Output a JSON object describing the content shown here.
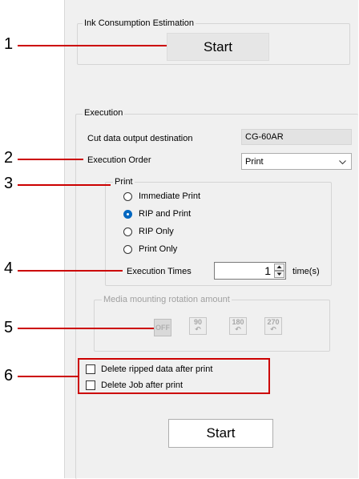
{
  "callouts": [
    "1",
    "2",
    "3",
    "4",
    "5",
    "6"
  ],
  "ink_estimation": {
    "group_title": "Ink Consumption Estimation",
    "start_label": "Start"
  },
  "execution": {
    "group_title": "Execution",
    "cut_output_label": "Cut data output destination",
    "cut_output_value": "CG-60AR",
    "order_label": "Execution Order",
    "order_value": "Print",
    "print_group_title": "Print",
    "print_options": [
      {
        "label": "Immediate Print",
        "checked": false
      },
      {
        "label": "RIP and Print",
        "checked": true
      },
      {
        "label": "RIP Only",
        "checked": false
      },
      {
        "label": "Print Only",
        "checked": false
      }
    ],
    "times_label": "Execution Times",
    "times_value": "1",
    "times_unit": "time(s)",
    "rotation_title": "Media mounting rotation amount",
    "rotation_options": [
      "OFF",
      "90",
      "180",
      "270"
    ],
    "delete_ripped_label": "Delete ripped data after print",
    "delete_job_label": "Delete Job after print",
    "start_label": "Start"
  },
  "colors": {
    "callout_red": "#cc0000",
    "radio_accent": "#0067c0",
    "panel_bg": "#f0f0f0"
  }
}
